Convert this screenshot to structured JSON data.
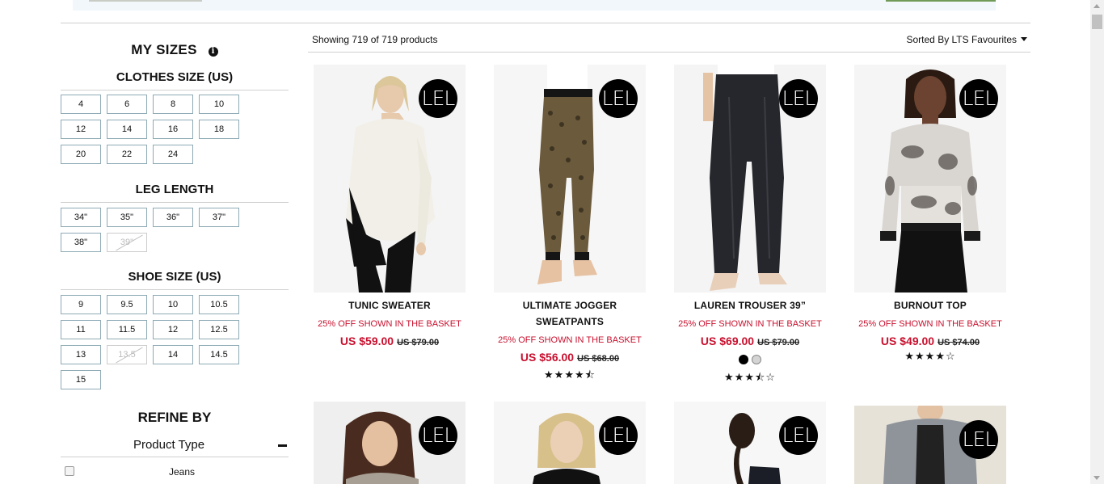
{
  "sidebar": {
    "my_sizes_title": "MY SIZES",
    "info_icon": "i",
    "clothes": {
      "title": "CLOTHES SIZE (US)",
      "sizes": [
        "4",
        "6",
        "8",
        "10",
        "12",
        "14",
        "16",
        "18",
        "20",
        "22",
        "24"
      ]
    },
    "leg": {
      "title": "LEG LENGTH",
      "sizes": [
        "34\"",
        "35\"",
        "36\"",
        "37\"",
        "38\"",
        "39\""
      ]
    },
    "shoe": {
      "title": "SHOE SIZE (US)",
      "sizes": [
        "9",
        "9.5",
        "10",
        "10.5",
        "11",
        "11.5",
        "12",
        "12.5",
        "13",
        "13.5",
        "14",
        "14.5",
        "15"
      ]
    },
    "refine_title": "REFINE BY",
    "product_type_label": "Product Type",
    "filter_first": "Jeans"
  },
  "main": {
    "showing": "Showing 719 of 719 products",
    "sort": "Sorted By LTS Favourites"
  },
  "brand_badge": "LEL",
  "products": [
    {
      "name": "TUNIC SWEATER",
      "promo": "25% OFF SHOWN IN THE BASKET",
      "price": "US $59.00",
      "was": "US $79.00",
      "stars": ""
    },
    {
      "name": "ULTIMATE JOGGER SWEATPANTS",
      "promo": "25% OFF SHOWN IN THE BASKET",
      "price": "US $56.00",
      "was": "US $68.00",
      "stars": "★★★★⯪"
    },
    {
      "name": "LAUREN TROUSER 39”",
      "promo": "25% OFF SHOWN IN THE BASKET",
      "price": "US $69.00",
      "was": "US $79.00",
      "stars": "★★★⯪☆",
      "swatches": [
        "#000000",
        "#d4d4d4"
      ]
    },
    {
      "name": "BURNOUT TOP",
      "promo": "25% OFF SHOWN IN THE BASKET",
      "price": "US $49.00",
      "was": "US $74.00",
      "stars": "★★★★☆"
    }
  ],
  "colors": {
    "accent_red": "#c8102e",
    "size_border": "#8eaab5"
  }
}
